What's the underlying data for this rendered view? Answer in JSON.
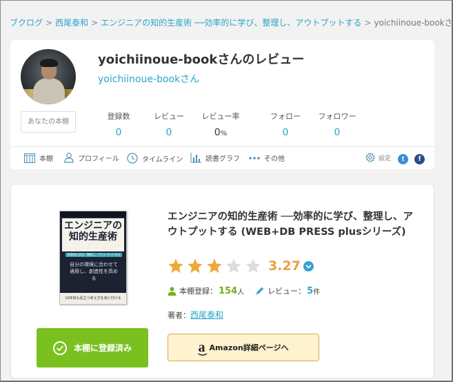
{
  "breadcrumb": {
    "items": [
      "ブクログ",
      "西尾泰和",
      "エンジニアの知的生産術 ──効率的に学び、整理し、アウトプットする"
    ],
    "current": "yoichiinoue-bookさんの"
  },
  "profile": {
    "title": "yoichiinoue-bookさんのレビュー",
    "subtitle": "yoichiinoue-bookさん",
    "shelf_button": "あなたの本棚",
    "stats": [
      {
        "label": "登録数",
        "value": "0"
      },
      {
        "label": "レビュー",
        "value": "0"
      },
      {
        "label": "レビュー率",
        "value": "0",
        "unit": "%"
      },
      {
        "label": "フォロー",
        "value": "0"
      },
      {
        "label": "フォロワー",
        "value": "0"
      }
    ],
    "nav": [
      "本棚",
      "プロフィール",
      "タイムライン",
      "読書グラフ",
      "その他"
    ],
    "settings": "設定",
    "social": {
      "twitter": "t",
      "facebook": "f"
    }
  },
  "book": {
    "title": "エンジニアの知的生産術 ──効率的に学び、整理し、アウトプットする (WEB+DB PRESS plusシリーズ)",
    "rating": "3.27",
    "rating_value": 3.27,
    "rating_max": 5,
    "shelf_label": "本棚登録：",
    "shelf_count": "154",
    "shelf_unit": "人",
    "review_label": "レビュー：",
    "review_count": "5",
    "review_unit": "件",
    "author_label": "著者：",
    "author": "西尾泰和",
    "cover": {
      "title": "エンジニアの\n知的生産術",
      "subtitle": "効率的に学び、整理し、アウトプットする",
      "tagline": "自分の環境に合わせて適用し、創造性を高める",
      "footer": "10年後も役立つ考え方を身に付ける"
    },
    "registered_button": "本棚に登録済み",
    "amazon_button": "Amazon詳細ページへ"
  },
  "colors": {
    "link": "#2aa5c8",
    "green": "#7ac120",
    "star": "#f0a83c",
    "star_empty": "#dddddd"
  }
}
